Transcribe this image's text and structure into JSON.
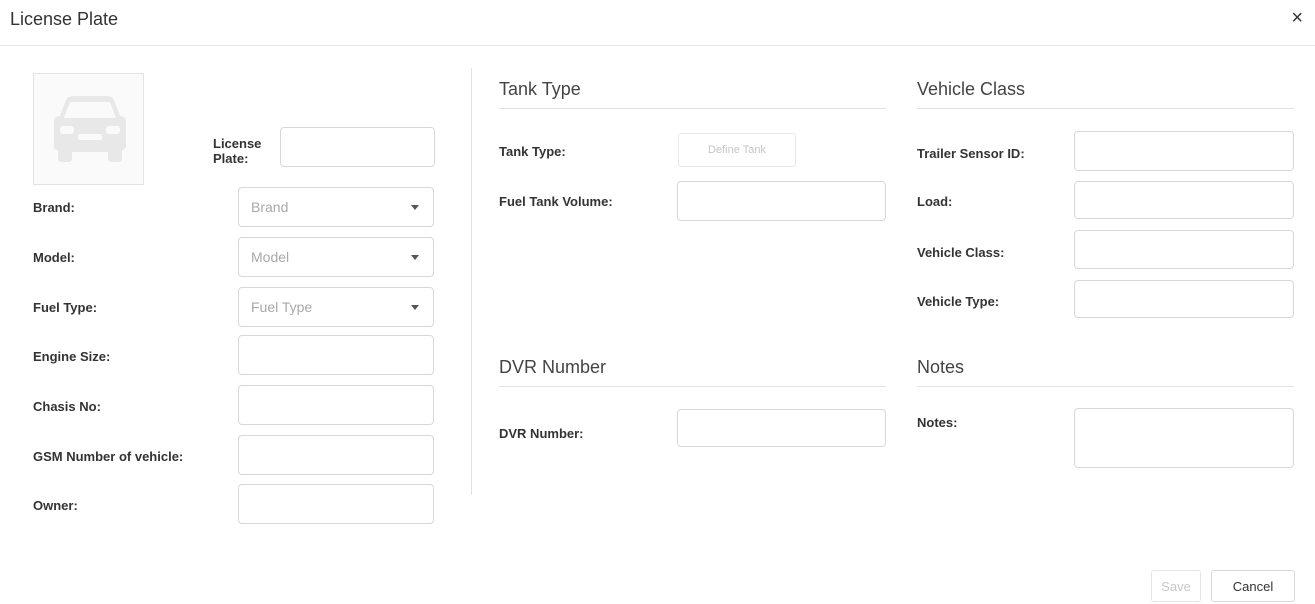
{
  "modal": {
    "title": "License Plate",
    "close_glyph": "×"
  },
  "left": {
    "license_plate_label": "License Plate:",
    "brand_label": "Brand:",
    "brand_placeholder": "Brand",
    "model_label": "Model:",
    "model_placeholder": "Model",
    "fuel_type_label": "Fuel Type:",
    "fuel_type_placeholder": "Fuel Type",
    "engine_size_label": "Engine Size:",
    "chasis_label": "Chasis No:",
    "gsm_label": "GSM Number of vehicle:",
    "owner_label": "Owner:"
  },
  "tank": {
    "title": "Tank Type",
    "tank_type_label": "Tank Type:",
    "define_button": "Define Tank",
    "fuel_volume_label": "Fuel Tank Volume:"
  },
  "dvr": {
    "title": "DVR Number",
    "dvr_label": "DVR Number:"
  },
  "vehicle_class": {
    "title": "Vehicle Class",
    "trailer_sensor_label": "Trailer Sensor ID:",
    "load_label": "Load:",
    "vehicle_class_label": "Vehicle Class:",
    "vehicle_type_label": "Vehicle Type:"
  },
  "notes": {
    "title": "Notes",
    "notes_label": "Notes:"
  },
  "footer": {
    "save_label": "Save",
    "cancel_label": "Cancel"
  },
  "icons": {
    "close": "close-icon",
    "vehicle_photo": "car-icon",
    "select_caret": "chevron-down-icon"
  },
  "colors": {
    "border": "#d8d8d8",
    "placeholder": "#a8a8a8",
    "disabled_text": "#c9c9c9"
  }
}
